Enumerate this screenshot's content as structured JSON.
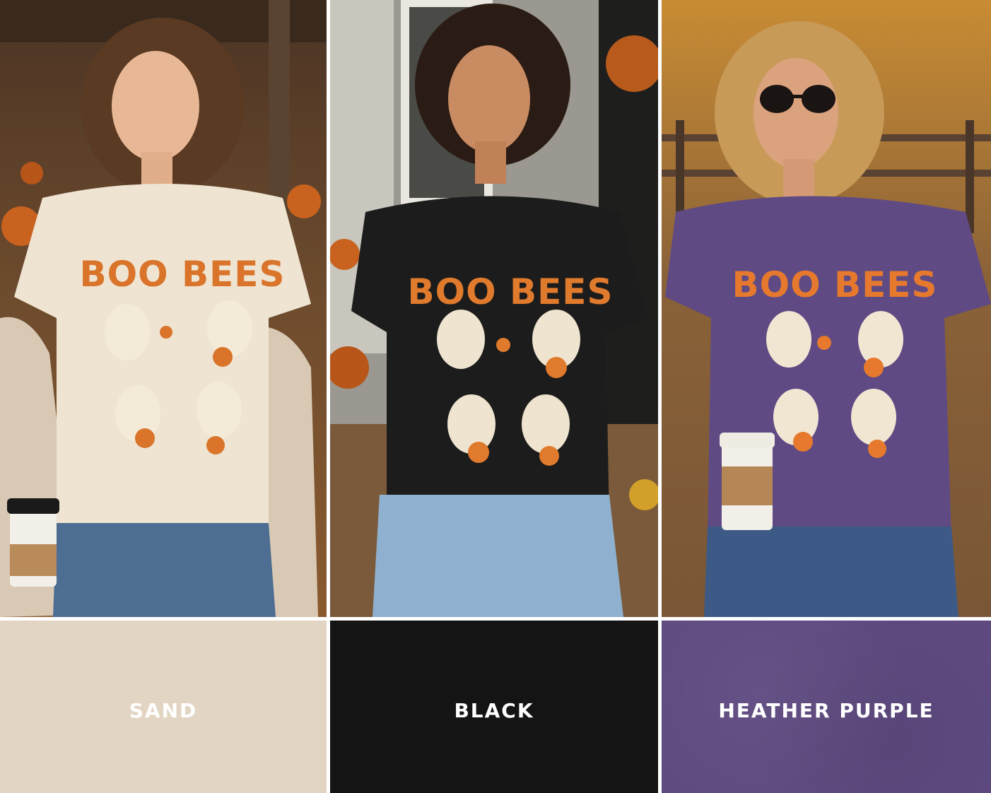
{
  "panels": [
    {
      "shirt_text": "BOO BEES",
      "swatch_label": "SAND",
      "colors": {
        "shirt": "#efe4d2",
        "swatch": "#e3d5c4",
        "background": "#6b4a30",
        "text": "#d9742a"
      }
    },
    {
      "shirt_text": "BOO BEES",
      "swatch_label": "BLACK",
      "colors": {
        "shirt": "#1c1c1c",
        "swatch": "#141414",
        "background": "#8a8a84",
        "text": "#e07a2c"
      }
    },
    {
      "shirt_text": "BOO BEES",
      "swatch_label": "HEATHER PURPLE",
      "colors": {
        "shirt": "#5f4a84",
        "swatch": "#5e4a80",
        "background": "#b87a2c",
        "text": "#e6792d"
      }
    }
  ]
}
